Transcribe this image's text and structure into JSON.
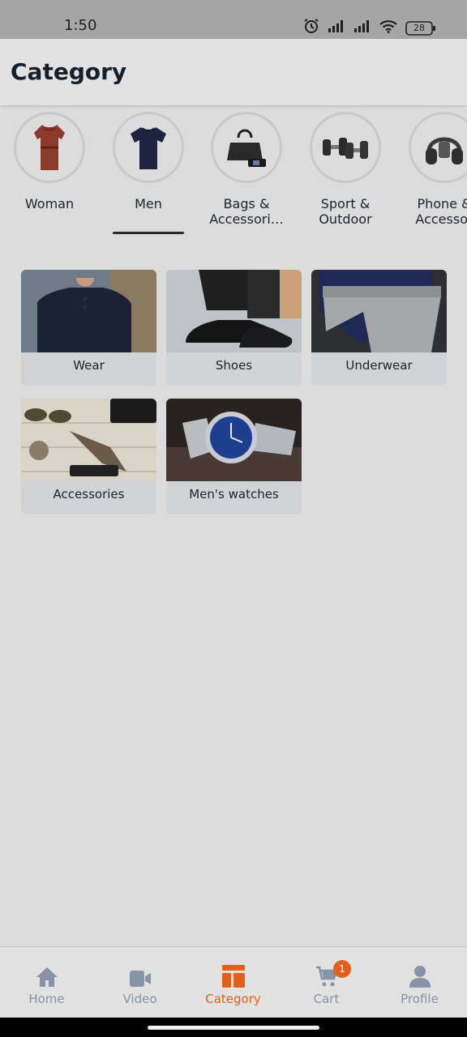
{
  "status_bar": {
    "time": "1:50",
    "battery": "28",
    "icons": [
      "alarm-icon",
      "signal-icon",
      "signal-icon",
      "wifi-icon",
      "battery-icon"
    ]
  },
  "header": {
    "title": "Category"
  },
  "category_tabs": {
    "active_index": 1,
    "items": [
      {
        "label": "Woman",
        "icon": "blouse-image"
      },
      {
        "label": "Men",
        "icon": "tshirt-image"
      },
      {
        "label": "Bags &\nAccessori…",
        "icon": "handbag-image"
      },
      {
        "label": "Sport &\nOutdoor",
        "icon": "dumbbell-image"
      },
      {
        "label": "Phone &\nAccessor",
        "icon": "headphones-image"
      }
    ]
  },
  "subcategories": {
    "items": [
      {
        "label": "Wear"
      },
      {
        "label": "Shoes"
      },
      {
        "label": "Underwear"
      },
      {
        "label": "Accessories"
      },
      {
        "label": "Men's watches"
      }
    ]
  },
  "bottom_nav": {
    "active": "Category",
    "accent_color": "#e2601b",
    "inactive_color": "#8793a6",
    "items": [
      {
        "label": "Home",
        "icon": "home-icon"
      },
      {
        "label": "Video",
        "icon": "video-icon"
      },
      {
        "label": "Category",
        "icon": "category-icon"
      },
      {
        "label": "Cart",
        "icon": "cart-icon",
        "badge": "1"
      },
      {
        "label": "Profile",
        "icon": "profile-icon"
      }
    ]
  }
}
